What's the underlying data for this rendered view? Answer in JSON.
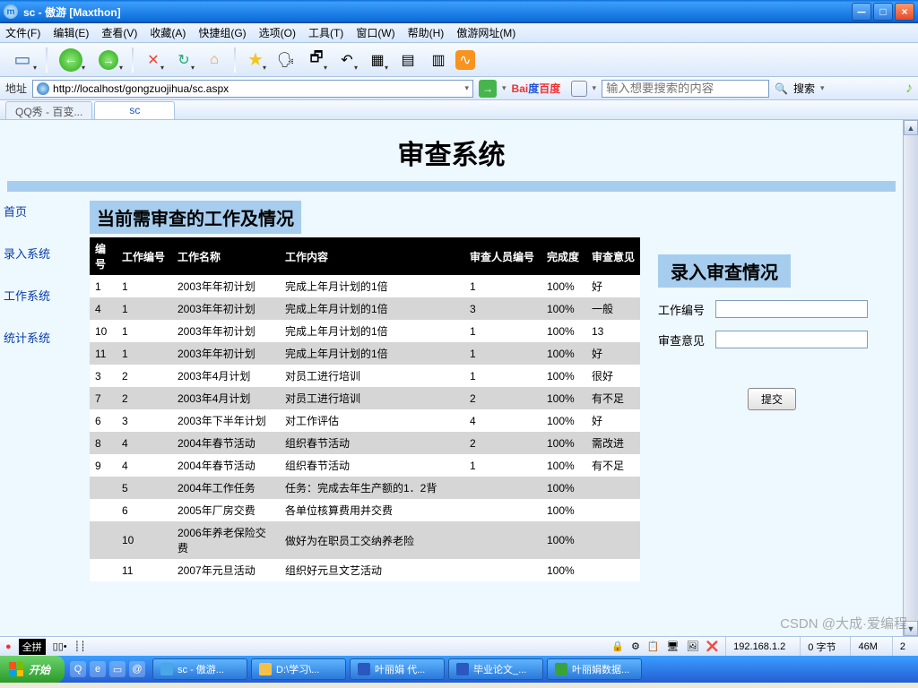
{
  "window": {
    "title": "sc - 傲游  [Maxthon]"
  },
  "menu": {
    "file": "文件(F)",
    "edit": "编辑(E)",
    "view": "查看(V)",
    "fav": "收藏(A)",
    "quick": "快捷组(G)",
    "opt": "选项(O)",
    "tool": "工具(T)",
    "win": "窗口(W)",
    "help": "帮助(H)",
    "maxsite": "傲游网址(M)"
  },
  "address": {
    "label": "地址",
    "url": "http://localhost/gongzuojihua/sc.aspx",
    "baidu": "Bai度百度",
    "search_placeholder": "输入想要搜索的内容",
    "search_btn": "搜索"
  },
  "tabs": {
    "t1": "QQ秀 - 百变...",
    "t2": "sc"
  },
  "page": {
    "title": "审查系统",
    "section_title": "当前需审查的工作及情况",
    "nav": {
      "home": "首页",
      "entry": "录入系统",
      "work": "工作系统",
      "stats": "统计系统"
    },
    "headers": {
      "c0": "编号",
      "c1": "工作编号",
      "c2": "工作名称",
      "c3": "工作内容",
      "c4": "审查人员编号",
      "c5": "完成度",
      "c6": "审查意见"
    },
    "rows": [
      {
        "c0": "1",
        "c1": "1",
        "c2": "2003年年初计划",
        "c3": "完成上年月计划的1倍",
        "c4": "1",
        "c5": "100%",
        "c6": "好"
      },
      {
        "c0": "4",
        "c1": "1",
        "c2": "2003年年初计划",
        "c3": "完成上年月计划的1倍",
        "c4": "3",
        "c5": "100%",
        "c6": "一般"
      },
      {
        "c0": "10",
        "c1": "1",
        "c2": "2003年年初计划",
        "c3": "完成上年月计划的1倍",
        "c4": "1",
        "c5": "100%",
        "c6": "13"
      },
      {
        "c0": "11",
        "c1": "1",
        "c2": "2003年年初计划",
        "c3": "完成上年月计划的1倍",
        "c4": "1",
        "c5": "100%",
        "c6": "好"
      },
      {
        "c0": "3",
        "c1": "2",
        "c2": "2003年4月计划",
        "c3": "对员工进行培训",
        "c4": "1",
        "c5": "100%",
        "c6": "很好"
      },
      {
        "c0": "7",
        "c1": "2",
        "c2": "2003年4月计划",
        "c3": "对员工进行培训",
        "c4": "2",
        "c5": "100%",
        "c6": "有不足"
      },
      {
        "c0": "6",
        "c1": "3",
        "c2": "2003年下半年计划",
        "c3": "对工作评估",
        "c4": "4",
        "c5": "100%",
        "c6": "好"
      },
      {
        "c0": "8",
        "c1": "4",
        "c2": "2004年春节活动",
        "c3": "组织春节活动",
        "c4": "2",
        "c5": "100%",
        "c6": "需改进"
      },
      {
        "c0": "9",
        "c1": "4",
        "c2": "2004年春节活动",
        "c3": "组织春节活动",
        "c4": "1",
        "c5": "100%",
        "c6": "有不足"
      },
      {
        "c0": "",
        "c1": "5",
        "c2": "2004年工作任务",
        "c3": "任务：完成去年生产额的1．2背",
        "c4": "",
        "c5": "100%",
        "c6": ""
      },
      {
        "c0": "",
        "c1": "6",
        "c2": "2005年厂房交费",
        "c3": "各单位核算费用并交费",
        "c4": "",
        "c5": "100%",
        "c6": ""
      },
      {
        "c0": "",
        "c1": "10",
        "c2": "2006年养老保险交费",
        "c3": "做好为在职员工交纳养老险",
        "c4": "",
        "c5": "100%",
        "c6": ""
      },
      {
        "c0": "",
        "c1": "11",
        "c2": "2007年元旦活动",
        "c3": "组织好元旦文艺活动",
        "c4": "",
        "c5": "100%",
        "c6": ""
      }
    ],
    "form": {
      "title": "录入审查情况",
      "work_id_label": "工作编号",
      "opinion_label": "审查意见",
      "submit": "提交"
    }
  },
  "status": {
    "ime": "全拼",
    "ip": "192.168.1.2",
    "bytes": "0 字节",
    "mem": "46M",
    "conn": "2"
  },
  "taskbar": {
    "start": "开始",
    "tasks": [
      "sc - 傲游...",
      "D:\\学习\\...",
      "叶丽娟 代...",
      "毕业论文_...",
      "叶丽娟数据..."
    ],
    "watermark": "CSDN @大成·爱编程"
  }
}
